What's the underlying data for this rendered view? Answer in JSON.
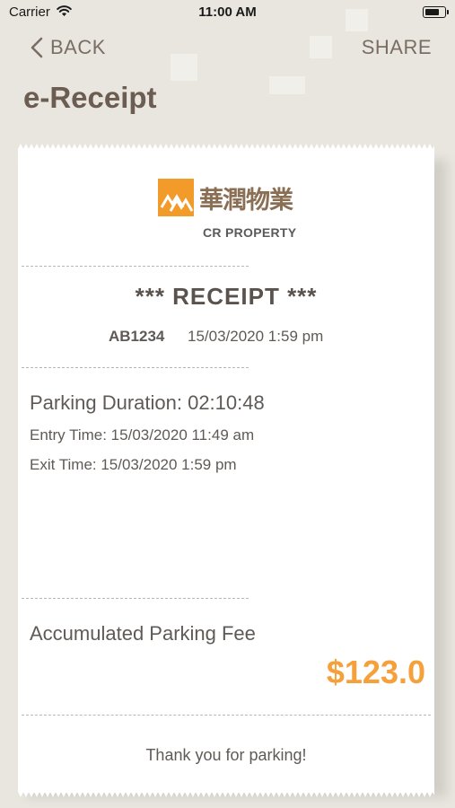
{
  "status_bar": {
    "carrier": "Carrier",
    "time": "11:00 AM"
  },
  "nav": {
    "back_label": "BACK",
    "share_label": "SHARE"
  },
  "page": {
    "title": "e-Receipt"
  },
  "receipt": {
    "logo_cn": "華潤物業",
    "logo_en": "CR PROPERTY",
    "heading": "*** RECEIPT ***",
    "plate": "AB1234",
    "issue_datetime": "15/03/2020 1:59 pm",
    "duration": "Parking Duration: 02:10:48",
    "entry_time": "Entry Time: 15/03/2020 11:49 am",
    "exit_time": "Exit Time: 15/03/2020 1:59 pm",
    "fee_label": "Accumulated Parking Fee",
    "fee_amount": "$123.0",
    "thanks": "Thank you for parking!"
  },
  "colors": {
    "background": "#e9e6df",
    "accent_orange": "#f5a03a",
    "logo_orange": "#f29a2a",
    "title_brown": "#6b5d52"
  }
}
